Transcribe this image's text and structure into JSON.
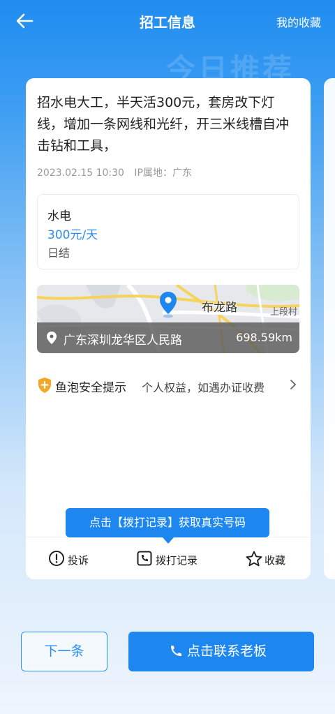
{
  "nav": {
    "title": "招工信息",
    "favorites_label": "我的收藏",
    "back_icon": "arrow-left-icon"
  },
  "watermark": "今日推荐",
  "job": {
    "description": "招水电大工，半天活300元，套房改下灯线，增加一条网线和光纤，开三米线槽自冲击钻和工具，",
    "date": "2023.02.15 10:30",
    "ip_location": "IP属地：广东",
    "type": "水电",
    "wage": "300元/天",
    "settlement": "日结"
  },
  "map": {
    "road_label": "布龙路",
    "village_label": "上段村",
    "address": "广东深圳龙华区人民路",
    "distance": "698.59km"
  },
  "safety": {
    "title": "鱼泡安全提示",
    "tip": "个人权益，如遇办证收费"
  },
  "tooltip": "点击【拨打记录】获取真实号码",
  "actions": {
    "complaint": "投诉",
    "call_records": "拨打记录",
    "favorite": "收藏"
  },
  "buttons": {
    "next": "下一条",
    "contact": "点击联系老板"
  },
  "colors": {
    "primary": "#1d87ef",
    "wage": "#2b8ef0",
    "shield": "#f5a623"
  }
}
